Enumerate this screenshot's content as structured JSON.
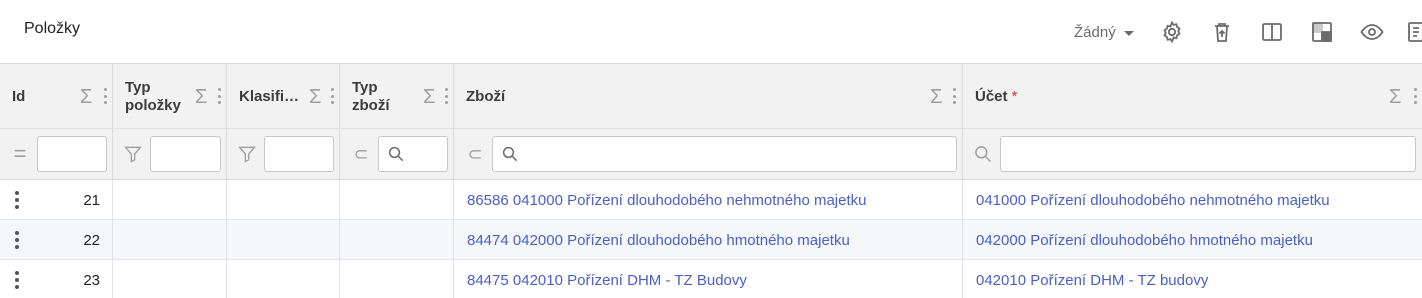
{
  "title": "Položky",
  "toolbar": {
    "view_select": "Žádný",
    "icons": [
      "gear-icon",
      "delete-icon",
      "columns-icon",
      "layout-icon",
      "eye-icon",
      "export-icon"
    ]
  },
  "columns": [
    {
      "key": "id",
      "label": "Id"
    },
    {
      "key": "typ_polozky",
      "label": "Typ položky"
    },
    {
      "key": "klasifikace",
      "label": "Klasifi…"
    },
    {
      "key": "typ_zbozi",
      "label": "Typ zboží"
    },
    {
      "key": "zbozi",
      "label": "Zboží"
    },
    {
      "key": "ucet",
      "label": "Účet",
      "required_mark": "*"
    }
  ],
  "filters": {
    "id_op": "=",
    "zbozi_op": "⊂",
    "typ_zbozi_op": "⊂"
  },
  "rows": [
    {
      "id": "21",
      "zbozi": "86586 041000 Pořízení dlouhodobého nehmotného majetku",
      "ucet": "041000 Pořízení dlouhodobého nehmotného majetku"
    },
    {
      "id": "22",
      "zbozi": "84474 042000 Pořízení dlouhodobého hmotného majetku",
      "ucet": "042000 Pořízení dlouhodobého hmotného majetku"
    },
    {
      "id": "23",
      "zbozi": "84475 042010 Pořízení DHM - TZ Budovy",
      "ucet": "042010 Pořízení DHM - TZ budovy"
    }
  ],
  "colors": {
    "link": "#4a5fc1",
    "required": "#d32f2f",
    "header_bg": "#f2f2f2"
  }
}
